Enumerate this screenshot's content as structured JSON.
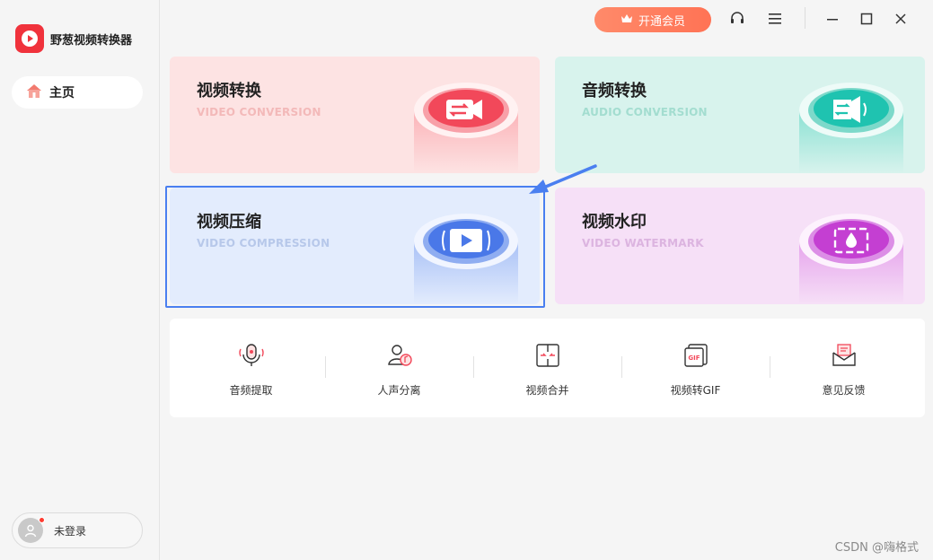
{
  "app": {
    "name": "野葱视频转换器"
  },
  "sidebar": {
    "home_label": "主页",
    "login_label": "未登录"
  },
  "titlebar": {
    "vip_label": "开通会员"
  },
  "cards": [
    {
      "title": "视频转换",
      "subtitle": "VIDEO CONVERSION",
      "icon": "video-convert-icon"
    },
    {
      "title": "音频转换",
      "subtitle": "AUDIO CONVERSION",
      "icon": "audio-convert-icon"
    },
    {
      "title": "视频压缩",
      "subtitle": "VIDEO COMPRESSION",
      "icon": "video-compress-icon"
    },
    {
      "title": "视频水印",
      "subtitle": "VIDEO WATERMARK",
      "icon": "video-watermark-icon"
    }
  ],
  "tools": [
    {
      "label": "音频提取",
      "icon": "microphone-icon"
    },
    {
      "label": "人声分离",
      "icon": "vocal-separate-icon"
    },
    {
      "label": "视频合并",
      "icon": "merge-icon"
    },
    {
      "label": "视频转GIF",
      "icon": "gif-icon"
    },
    {
      "label": "意见反馈",
      "icon": "mail-icon"
    }
  ],
  "watermark": "CSDN @嗨格式",
  "colors": {
    "brand_red": "#f0323c",
    "vip_orange": "#ff7a5e",
    "highlight_blue": "#4a7ff0"
  }
}
